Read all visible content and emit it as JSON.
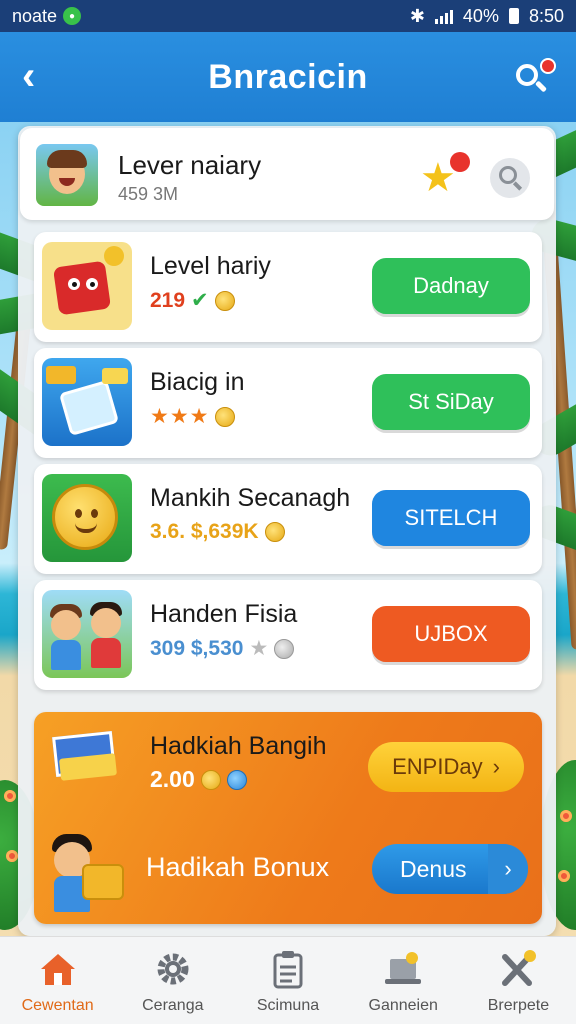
{
  "status_bar": {
    "carrier": "noate",
    "battery": "40%",
    "time": "8:50"
  },
  "header": {
    "title": "Bnracicin"
  },
  "profile": {
    "name": "Lever naiary",
    "subtitle": "459 3M"
  },
  "items": [
    {
      "title": "Level hariy",
      "meta_value": "219",
      "meta_extra": "✔",
      "button_label": "Dadnay",
      "button_color": "#2fc05a"
    },
    {
      "title": "Biacig in",
      "meta_stars": "★★★",
      "button_label": "St SiDay",
      "button_color": "#2fc05a"
    },
    {
      "title": "Mankih Secanagh",
      "meta_value": "3.6. $,639K",
      "button_label": "SITELCH",
      "button_color": "#1f86e0"
    },
    {
      "title": "Handen Fisia",
      "meta_value": "309 $,530",
      "meta_star": "★",
      "button_label": "UJBOX",
      "button_color": "#ee5a22"
    }
  ],
  "bonus": {
    "title": "Hadkiah Bangih",
    "value": "2.00",
    "button_label": "ENPIDay",
    "title2": "Hadikah Bonux",
    "button2_label": "Denus"
  },
  "nav": [
    {
      "label": "Cewentan",
      "icon": "home-icon"
    },
    {
      "label": "Ceranga",
      "icon": "gear-icon"
    },
    {
      "label": "Scimuna",
      "icon": "clipboard-icon"
    },
    {
      "label": "Ganneien",
      "icon": "laptop-icon"
    },
    {
      "label": "Brerpete",
      "icon": "tools-icon"
    }
  ],
  "colors": {
    "header": "#1f7fd3",
    "accent_orange": "#ee7a1a",
    "active_nav": "#e06a18"
  }
}
